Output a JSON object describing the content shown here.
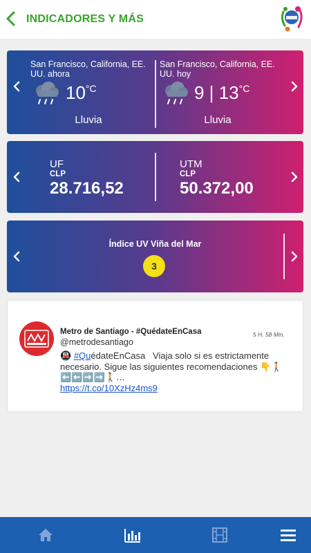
{
  "header": {
    "title": "INDICADORES Y MÁS",
    "logo_alt": "CANAL 13"
  },
  "weather": {
    "now": {
      "location": "San Francisco, California, EE. UU. ahora",
      "temp": "10",
      "unit": "°C",
      "desc": "Lluvia",
      "icon": "rain-cloud-icon"
    },
    "today": {
      "location": "San Francisco, California, EE. UU. hoy",
      "temp": "9 | 13",
      "unit": "°C",
      "desc": "Lluvia",
      "icon": "rain-cloud-icon"
    }
  },
  "indicators": {
    "uf": {
      "name": "UF",
      "unit": "CLP",
      "value": "28.716,52"
    },
    "utm": {
      "name": "UTM",
      "unit": "CLP",
      "value": "50.372,00"
    }
  },
  "uv": {
    "title": "Índice UV Viña del Mar",
    "value": "3",
    "badge_color": "#f5df16"
  },
  "tweet": {
    "name": "Metro de Santiago - #QuédateEnCasa",
    "handle": "@metrodesantiago",
    "time": "5 H. 58 Min.",
    "hashtag": "#Qu",
    "hashtag_rest": "édateEnCasa",
    "text": "Viaja solo si es estrictamente necesario. Sigue las siguientes recomendaciones 👇🚶⬅️⬅️➡️➡️🚶…",
    "link": "https://t.co/10XzHz4ms9"
  },
  "bottom_nav": [
    "home-icon",
    "chart-icon",
    "film-icon",
    "menu-icon"
  ],
  "colors": {
    "accent_green": "#3aa32c",
    "nav_blue": "#1d5fb0",
    "gradient_start": "#1e4f9c",
    "gradient_end": "#cf1f6f"
  }
}
